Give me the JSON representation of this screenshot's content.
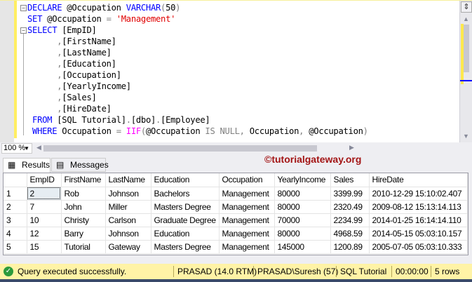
{
  "editor": {
    "lines": [
      [
        {
          "t": "DECLARE",
          "c": "kw"
        },
        {
          "t": " @Occupation ",
          "c": "ent"
        },
        {
          "t": "VARCHAR",
          "c": "kw"
        },
        {
          "t": "(",
          "c": "gr"
        },
        {
          "t": "50",
          "c": "ent"
        },
        {
          "t": ")",
          "c": "gr"
        }
      ],
      [
        {
          "t": "SET",
          "c": "kw"
        },
        {
          "t": " @Occupation ",
          "c": "ent"
        },
        {
          "t": "=",
          "c": "gr"
        },
        {
          "t": " ",
          "c": "ent"
        },
        {
          "t": "'Management'",
          "c": "str"
        }
      ],
      [
        {
          "t": "SELECT",
          "c": "kw"
        },
        {
          "t": " [EmpID]",
          "c": "ent"
        }
      ],
      [
        {
          "t": "      ",
          "c": "ent"
        },
        {
          "t": ",",
          "c": "gr"
        },
        {
          "t": "[FirstName]",
          "c": "ent"
        }
      ],
      [
        {
          "t": "      ",
          "c": "ent"
        },
        {
          "t": ",",
          "c": "gr"
        },
        {
          "t": "[LastName]",
          "c": "ent"
        }
      ],
      [
        {
          "t": "      ",
          "c": "ent"
        },
        {
          "t": ",",
          "c": "gr"
        },
        {
          "t": "[Education]",
          "c": "ent"
        }
      ],
      [
        {
          "t": "      ",
          "c": "ent"
        },
        {
          "t": ",",
          "c": "gr"
        },
        {
          "t": "[Occupation]",
          "c": "ent"
        }
      ],
      [
        {
          "t": "      ",
          "c": "ent"
        },
        {
          "t": ",",
          "c": "gr"
        },
        {
          "t": "[YearlyIncome]",
          "c": "ent"
        }
      ],
      [
        {
          "t": "      ",
          "c": "ent"
        },
        {
          "t": ",",
          "c": "gr"
        },
        {
          "t": "[Sales]",
          "c": "ent"
        }
      ],
      [
        {
          "t": "      ",
          "c": "ent"
        },
        {
          "t": ",",
          "c": "gr"
        },
        {
          "t": "[HireDate]",
          "c": "ent"
        }
      ],
      [
        {
          "t": " FROM",
          "c": "kw"
        },
        {
          "t": " [SQL Tutorial]",
          "c": "ent"
        },
        {
          "t": ".",
          "c": "gr"
        },
        {
          "t": "[dbo]",
          "c": "ent"
        },
        {
          "t": ".",
          "c": "gr"
        },
        {
          "t": "[Employee]",
          "c": "ent"
        }
      ],
      [
        {
          "t": " WHERE",
          "c": "kw"
        },
        {
          "t": " Occupation ",
          "c": "ent"
        },
        {
          "t": "=",
          "c": "gr"
        },
        {
          "t": " ",
          "c": "ent"
        },
        {
          "t": "IIF",
          "c": "fn"
        },
        {
          "t": "(",
          "c": "gr"
        },
        {
          "t": "@Occupation ",
          "c": "ent"
        },
        {
          "t": "IS NULL",
          "c": "gr"
        },
        {
          "t": ",",
          "c": "gr"
        },
        {
          "t": " Occupation",
          "c": "ent"
        },
        {
          "t": ",",
          "c": "gr"
        },
        {
          "t": " @Occupation",
          "c": "ent"
        },
        {
          "t": ")",
          "c": "gr"
        }
      ]
    ]
  },
  "zoom": {
    "value": "100 %"
  },
  "watermark": "©tutorialgateway.org",
  "tabs": [
    {
      "label": "Results",
      "icon": "grid-icon",
      "active": true
    },
    {
      "label": "Messages",
      "icon": "messages-icon",
      "active": false
    }
  ],
  "grid": {
    "columns": [
      "",
      "EmpID",
      "FirstName",
      "LastName",
      "Education",
      "Occupation",
      "YearlyIncome",
      "Sales",
      "HireDate"
    ],
    "rows": [
      [
        "1",
        "2",
        "Rob",
        "Johnson",
        "Bachelors",
        "Management",
        "80000",
        "3399.99",
        "2010-12-29 15:10:02.407"
      ],
      [
        "2",
        "7",
        "John",
        "Miller",
        "Masters Degree",
        "Management",
        "80000",
        "2320.49",
        "2009-08-12 15:13:14.113"
      ],
      [
        "3",
        "10",
        "Christy",
        "Carlson",
        "Graduate Degree",
        "Management",
        "70000",
        "2234.99",
        "2014-01-25 16:14:14.110"
      ],
      [
        "4",
        "12",
        "Barry",
        "Johnson",
        "Education",
        "Management",
        "80000",
        "4968.59",
        "2014-05-15 05:03:10.157"
      ],
      [
        "5",
        "15",
        "Tutorial",
        "Gateway",
        "Masters Degree",
        "Management",
        "145000",
        "1200.89",
        "2005-07-05 05:03:10.333"
      ]
    ]
  },
  "status": {
    "message": "Query executed successfully.",
    "server": "PRASAD (14.0 RTM)",
    "user": "PRASAD\\Suresh (57)",
    "database": "SQL Tutorial",
    "elapsed": "00:00:00",
    "rows": "5 rows",
    "color": "#fff3a6"
  }
}
